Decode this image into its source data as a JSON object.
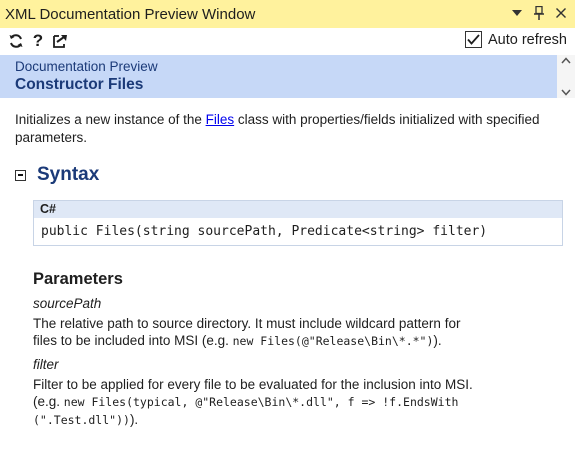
{
  "window": {
    "title": "XML Documentation Preview Window"
  },
  "toolbar": {
    "help_glyph": "?",
    "auto_refresh_label": "Auto refresh",
    "auto_refresh_checked": true
  },
  "header": {
    "breadcrumb": "Documentation Preview",
    "page_title": "Constructor Files"
  },
  "summary": {
    "before_link": "Initializes a new instance of the ",
    "link_text": "Files",
    "after_link": " class with properties/fields initialized with specified parameters."
  },
  "syntax": {
    "heading": "Syntax",
    "language": "C#",
    "code": "public Files(string sourcePath, Predicate<string> filter)"
  },
  "parameters": {
    "heading": "Parameters",
    "items": [
      {
        "name": "sourcePath",
        "desc_lines": [
          "The relative path to source directory. It must include wildcard pattern for",
          "files to be included into MSI (e.g. "
        ],
        "code_inline": "new Files(@\"Release\\Bin\\*.*\")",
        "desc_tail": ")."
      },
      {
        "name": "filter",
        "desc_line1": "Filter to be applied for every file to be evaluated for the inclusion into MSI.",
        "desc_line2_prefix": "(e.g. ",
        "code_line2": "new Files(typical, @\"Release\\Bin\\*.dll\", f => !f.EndsWith",
        "code_line3": "(\".Test.dll\"))",
        "desc_tail": ")."
      }
    ]
  },
  "colors": {
    "titlebar": "#fff29d",
    "header_bg": "#c6d8f7",
    "heading_blue": "#1b3a78",
    "link": "#0000ee"
  }
}
